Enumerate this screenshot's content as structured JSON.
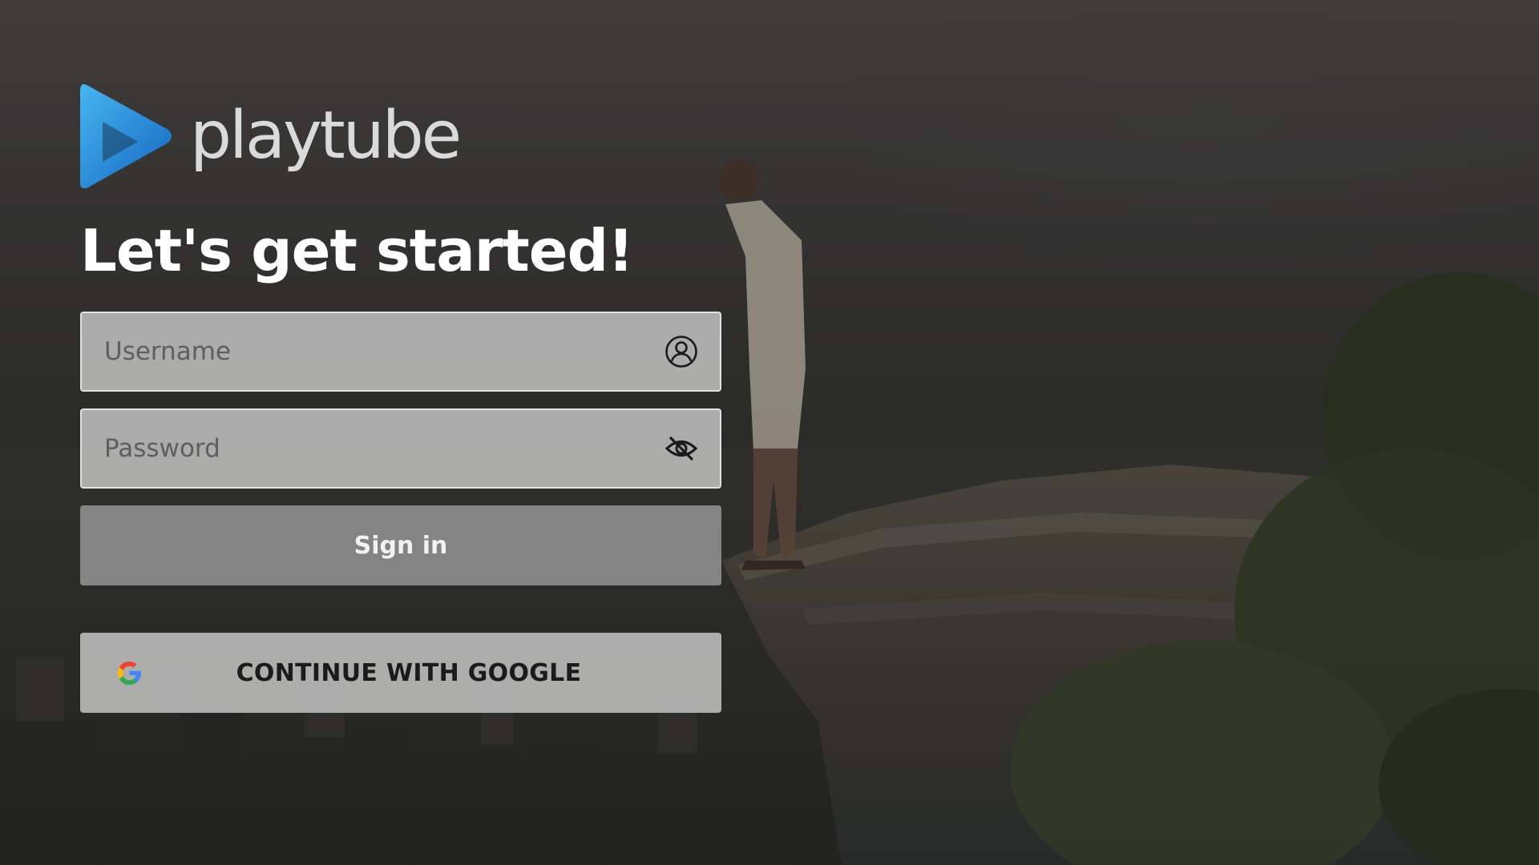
{
  "app": {
    "brand_name": "playtube",
    "heading": "Let's get started!"
  },
  "login_form": {
    "username": {
      "placeholder": "Username",
      "value": "",
      "icon": "user-circle-icon"
    },
    "password": {
      "placeholder": "Password",
      "value": "",
      "icon": "eye-off-icon"
    },
    "sign_in_label": "Sign in",
    "google_label": "CONTINUE WITH GOOGLE",
    "google_icon": "google-g-icon"
  },
  "colors": {
    "logo_blue_light": "#3aa7e8",
    "logo_blue_dark": "#1565c0",
    "text_white": "#ffffff",
    "google_blue": "#4285F4",
    "google_red": "#EA4335",
    "google_yellow": "#FBBC05",
    "google_green": "#34A853"
  }
}
